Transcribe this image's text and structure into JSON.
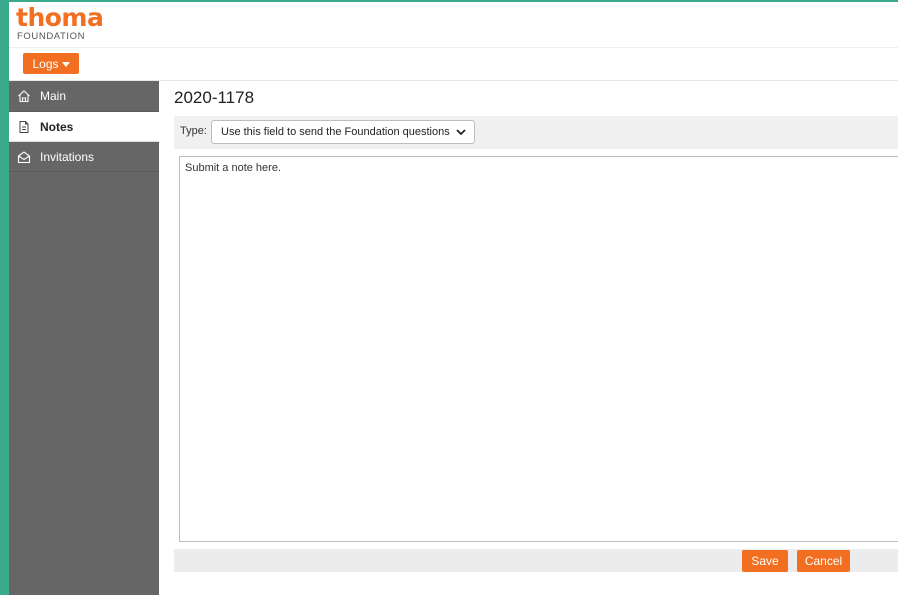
{
  "brand": {
    "name": "thoma",
    "subtitle": "FOUNDATION",
    "color": "#f26f21"
  },
  "toolbar": {
    "logs_label": "Logs"
  },
  "sidebar": {
    "items": [
      {
        "label": "Main",
        "icon": "home-icon",
        "active": false
      },
      {
        "label": "Notes",
        "icon": "document-icon",
        "active": true
      },
      {
        "label": "Invitations",
        "icon": "envelope-open-icon",
        "active": false
      }
    ]
  },
  "main": {
    "title": "2020-1178",
    "type_label": "Type:",
    "type_selected": "Use this field to send the Foundation questions",
    "note_placeholder": "Submit a note here.",
    "save_label": "Save",
    "cancel_label": "Cancel"
  }
}
